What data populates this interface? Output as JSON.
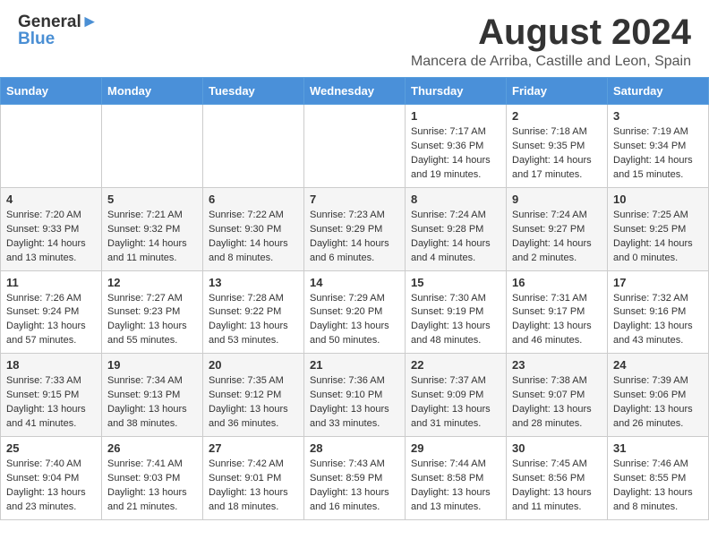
{
  "header": {
    "logo_line1_general": "General",
    "logo_line1_blue": "Blue",
    "logo_line2": "Blue",
    "month_title": "August 2024",
    "location": "Mancera de Arriba, Castille and Leon, Spain"
  },
  "days_of_week": [
    "Sunday",
    "Monday",
    "Tuesday",
    "Wednesday",
    "Thursday",
    "Friday",
    "Saturday"
  ],
  "weeks": [
    [
      {
        "day": "",
        "info": ""
      },
      {
        "day": "",
        "info": ""
      },
      {
        "day": "",
        "info": ""
      },
      {
        "day": "",
        "info": ""
      },
      {
        "day": "1",
        "info": "Sunrise: 7:17 AM\nSunset: 9:36 PM\nDaylight: 14 hours\nand 19 minutes."
      },
      {
        "day": "2",
        "info": "Sunrise: 7:18 AM\nSunset: 9:35 PM\nDaylight: 14 hours\nand 17 minutes."
      },
      {
        "day": "3",
        "info": "Sunrise: 7:19 AM\nSunset: 9:34 PM\nDaylight: 14 hours\nand 15 minutes."
      }
    ],
    [
      {
        "day": "4",
        "info": "Sunrise: 7:20 AM\nSunset: 9:33 PM\nDaylight: 14 hours\nand 13 minutes."
      },
      {
        "day": "5",
        "info": "Sunrise: 7:21 AM\nSunset: 9:32 PM\nDaylight: 14 hours\nand 11 minutes."
      },
      {
        "day": "6",
        "info": "Sunrise: 7:22 AM\nSunset: 9:30 PM\nDaylight: 14 hours\nand 8 minutes."
      },
      {
        "day": "7",
        "info": "Sunrise: 7:23 AM\nSunset: 9:29 PM\nDaylight: 14 hours\nand 6 minutes."
      },
      {
        "day": "8",
        "info": "Sunrise: 7:24 AM\nSunset: 9:28 PM\nDaylight: 14 hours\nand 4 minutes."
      },
      {
        "day": "9",
        "info": "Sunrise: 7:24 AM\nSunset: 9:27 PM\nDaylight: 14 hours\nand 2 minutes."
      },
      {
        "day": "10",
        "info": "Sunrise: 7:25 AM\nSunset: 9:25 PM\nDaylight: 14 hours\nand 0 minutes."
      }
    ],
    [
      {
        "day": "11",
        "info": "Sunrise: 7:26 AM\nSunset: 9:24 PM\nDaylight: 13 hours\nand 57 minutes."
      },
      {
        "day": "12",
        "info": "Sunrise: 7:27 AM\nSunset: 9:23 PM\nDaylight: 13 hours\nand 55 minutes."
      },
      {
        "day": "13",
        "info": "Sunrise: 7:28 AM\nSunset: 9:22 PM\nDaylight: 13 hours\nand 53 minutes."
      },
      {
        "day": "14",
        "info": "Sunrise: 7:29 AM\nSunset: 9:20 PM\nDaylight: 13 hours\nand 50 minutes."
      },
      {
        "day": "15",
        "info": "Sunrise: 7:30 AM\nSunset: 9:19 PM\nDaylight: 13 hours\nand 48 minutes."
      },
      {
        "day": "16",
        "info": "Sunrise: 7:31 AM\nSunset: 9:17 PM\nDaylight: 13 hours\nand 46 minutes."
      },
      {
        "day": "17",
        "info": "Sunrise: 7:32 AM\nSunset: 9:16 PM\nDaylight: 13 hours\nand 43 minutes."
      }
    ],
    [
      {
        "day": "18",
        "info": "Sunrise: 7:33 AM\nSunset: 9:15 PM\nDaylight: 13 hours\nand 41 minutes."
      },
      {
        "day": "19",
        "info": "Sunrise: 7:34 AM\nSunset: 9:13 PM\nDaylight: 13 hours\nand 38 minutes."
      },
      {
        "day": "20",
        "info": "Sunrise: 7:35 AM\nSunset: 9:12 PM\nDaylight: 13 hours\nand 36 minutes."
      },
      {
        "day": "21",
        "info": "Sunrise: 7:36 AM\nSunset: 9:10 PM\nDaylight: 13 hours\nand 33 minutes."
      },
      {
        "day": "22",
        "info": "Sunrise: 7:37 AM\nSunset: 9:09 PM\nDaylight: 13 hours\nand 31 minutes."
      },
      {
        "day": "23",
        "info": "Sunrise: 7:38 AM\nSunset: 9:07 PM\nDaylight: 13 hours\nand 28 minutes."
      },
      {
        "day": "24",
        "info": "Sunrise: 7:39 AM\nSunset: 9:06 PM\nDaylight: 13 hours\nand 26 minutes."
      }
    ],
    [
      {
        "day": "25",
        "info": "Sunrise: 7:40 AM\nSunset: 9:04 PM\nDaylight: 13 hours\nand 23 minutes."
      },
      {
        "day": "26",
        "info": "Sunrise: 7:41 AM\nSunset: 9:03 PM\nDaylight: 13 hours\nand 21 minutes."
      },
      {
        "day": "27",
        "info": "Sunrise: 7:42 AM\nSunset: 9:01 PM\nDaylight: 13 hours\nand 18 minutes."
      },
      {
        "day": "28",
        "info": "Sunrise: 7:43 AM\nSunset: 8:59 PM\nDaylight: 13 hours\nand 16 minutes."
      },
      {
        "day": "29",
        "info": "Sunrise: 7:44 AM\nSunset: 8:58 PM\nDaylight: 13 hours\nand 13 minutes."
      },
      {
        "day": "30",
        "info": "Sunrise: 7:45 AM\nSunset: 8:56 PM\nDaylight: 13 hours\nand 11 minutes."
      },
      {
        "day": "31",
        "info": "Sunrise: 7:46 AM\nSunset: 8:55 PM\nDaylight: 13 hours\nand 8 minutes."
      }
    ]
  ]
}
